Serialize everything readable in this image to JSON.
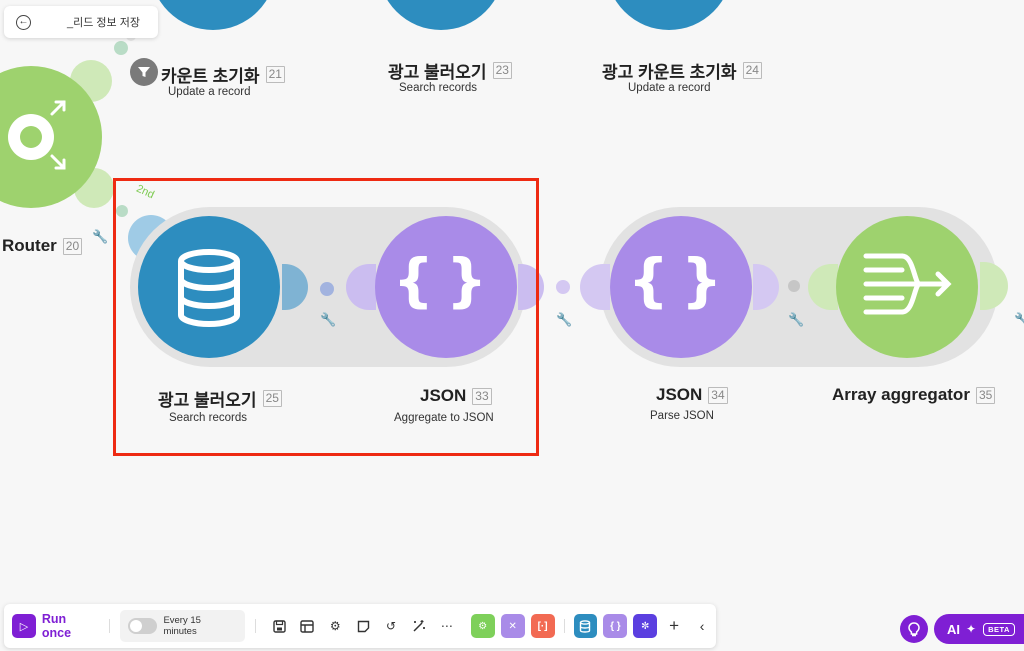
{
  "back_chip": {
    "label": "_리드 정보 저장"
  },
  "top_row": [
    {
      "title": "카운트 초기화",
      "num": "21",
      "sub": "Update a record"
    },
    {
      "title": "광고 불러오기",
      "num": "23",
      "sub": "Search records"
    },
    {
      "title": "광고 카운트 초기화",
      "num": "24",
      "sub": "Update a record"
    }
  ],
  "router": {
    "title": "Router",
    "num": "20"
  },
  "route_label": "2nd",
  "modules": [
    {
      "title": "광고 불러오기",
      "num": "25",
      "sub": "Search records"
    },
    {
      "title": "JSON",
      "num": "33",
      "sub": "Aggregate to JSON"
    },
    {
      "title": "JSON",
      "num": "34",
      "sub": "Parse JSON"
    },
    {
      "title": "Array aggregator",
      "num": "35",
      "sub": ""
    }
  ],
  "toolbar": {
    "run_label": "Run once",
    "schedule_label": "Every 15 minutes"
  },
  "ai": {
    "label": "AI",
    "badge": "BETA"
  },
  "colors": {
    "datastore": "#2d8dbf",
    "json": "#a98be8",
    "router": "#9ed26e",
    "aggregator": "#9ed26e",
    "accent": "#7f1fd4",
    "highlight": "#ee2a12"
  }
}
